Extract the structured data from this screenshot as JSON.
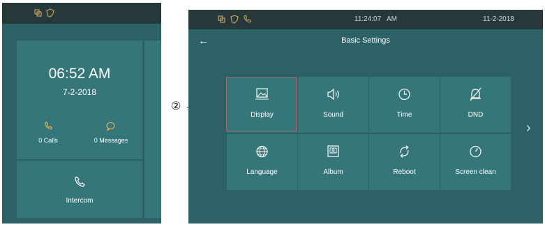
{
  "left_screen": {
    "clock": {
      "time": "06:52 AM",
      "date": "7-2-2018"
    },
    "calls": {
      "label": "0 Calls",
      "icon": "phone-icon"
    },
    "messages": {
      "label": "0 Messages",
      "icon": "chat-bubble-icon"
    },
    "intercom": {
      "label": "Intercom",
      "icon": "phone-icon"
    }
  },
  "right_screen": {
    "status": {
      "time": "11:24:07",
      "period": "AM",
      "date": "11-2-2018"
    },
    "title": "Basic Settings",
    "tiles": [
      {
        "label": "Display",
        "icon": "image-icon"
      },
      {
        "label": "Sound",
        "icon": "speaker-icon"
      },
      {
        "label": "Time",
        "icon": "clock-icon"
      },
      {
        "label": "DND",
        "icon": "bell-off-icon"
      },
      {
        "label": "Language",
        "icon": "globe-icon"
      },
      {
        "label": "Album",
        "icon": "contact-card-icon"
      },
      {
        "label": "Reboot",
        "icon": "refresh-icon"
      },
      {
        "label": "Screen clean",
        "icon": "timer-icon"
      }
    ]
  },
  "callout": {
    "number": "②"
  },
  "colors": {
    "screen_bg": "#2c6165",
    "tile_bg": "#35767a",
    "status_bar": "#27383b",
    "status_icon": "#c9a062",
    "selection": "#a46468"
  }
}
